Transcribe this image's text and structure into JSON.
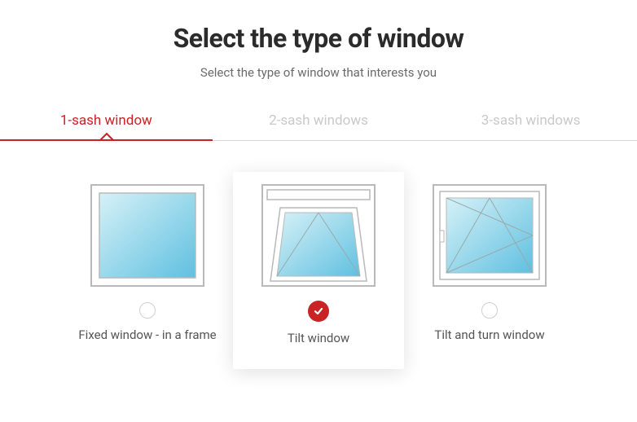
{
  "header": {
    "title": "Select the type of window",
    "subtitle": "Select the type of window that interests you"
  },
  "tabs": [
    {
      "label": "1-sash window",
      "active": true
    },
    {
      "label": "2-sash windows",
      "active": false
    },
    {
      "label": "3-sash windows",
      "active": false
    }
  ],
  "options": [
    {
      "id": "fixed",
      "label": "Fixed window - in a frame",
      "selected": false
    },
    {
      "id": "tilt",
      "label": "Tilt window",
      "selected": true
    },
    {
      "id": "tilt-turn",
      "label": "Tilt and turn window",
      "selected": false
    }
  ],
  "colors": {
    "accent": "#c92323",
    "glass_top": "#bde7f2",
    "glass_bottom": "#5fc0e0",
    "frame": "#b9b9b9"
  }
}
